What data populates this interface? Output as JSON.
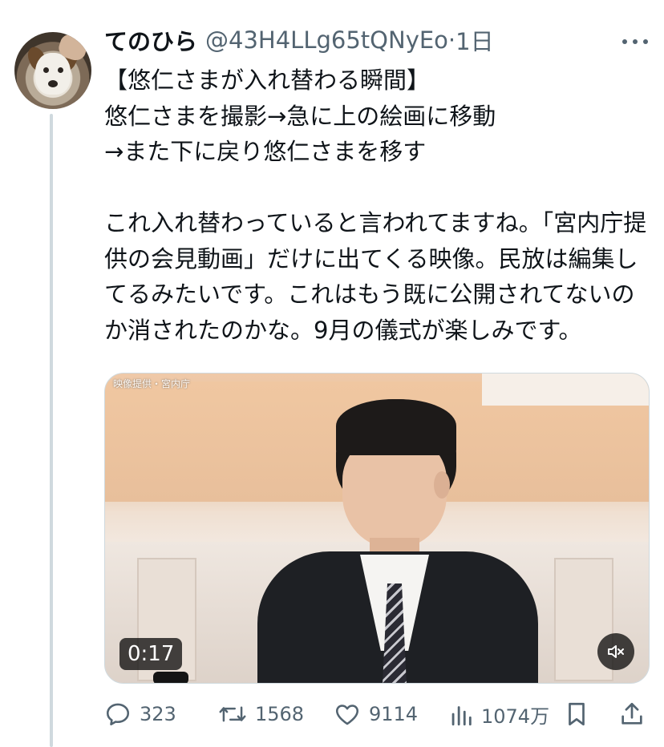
{
  "tweet": {
    "author_name": "てのひら",
    "author_handle": "@43H4LLg65tQNyEo",
    "separator": "·",
    "time_ago": "1日",
    "text": "【悠仁さまが入れ替わる瞬間】\n悠仁さまを撮影→急に上の絵画に移動\n→また下に戻り悠仁さまを移す\n\nこれ入れ替わっていると言われてますね。「宮内庁提供の会見動画」だけに出てくる映像。民放は編集してるみたいです。これはもう既に公開されてないのか消されたのかな。9月の儀式が楽しみです。"
  },
  "media": {
    "watermark": "映像提供・宮内庁",
    "duration": "0:17",
    "muted": true
  },
  "actions": {
    "replies": "323",
    "retweets": "1568",
    "likes": "9114",
    "views": "1074万"
  },
  "icons": {
    "more": "more-horizontal-icon",
    "reply": "reply-icon",
    "retweet": "retweet-icon",
    "like": "heart-icon",
    "views": "views-chart-icon",
    "bookmark": "bookmark-icon",
    "share": "share-icon",
    "mute": "speaker-muted-icon"
  },
  "colors": {
    "text": "#0f1419",
    "secondary": "#536471",
    "thread_line": "#cfd9de"
  }
}
